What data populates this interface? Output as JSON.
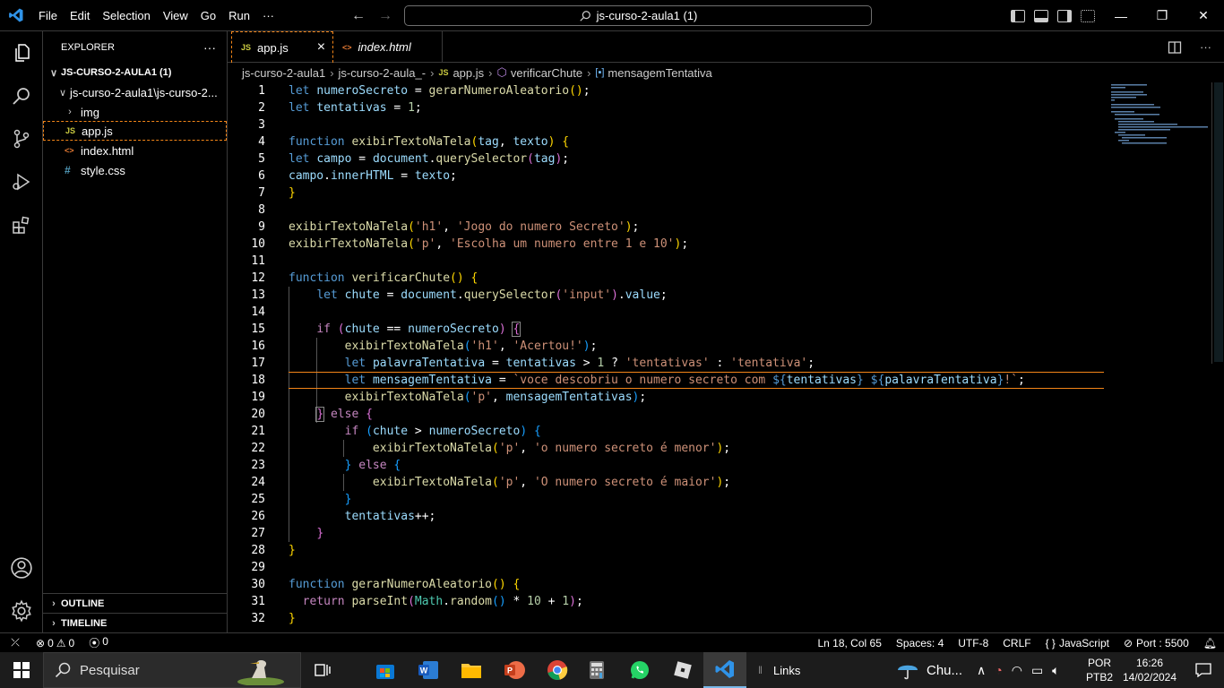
{
  "window": {
    "title": "js-curso-2-aula1 (1)",
    "menu": [
      "File",
      "Edit",
      "Selection",
      "View",
      "Go",
      "Run",
      "···"
    ]
  },
  "sidebar": {
    "header": "EXPLORER",
    "more": "···",
    "root": "JS-CURSO-2-AULA1 (1)",
    "folder": "js-curso-2-aula1\\js-curso-2...",
    "items": [
      {
        "label": "img",
        "icon": "folder-chevron"
      },
      {
        "label": "app.js",
        "icon": "JS"
      },
      {
        "label": "index.html",
        "icon": "<>"
      },
      {
        "label": "style.css",
        "icon": "#"
      }
    ],
    "outline": "OUTLINE",
    "timeline": "TIMELINE"
  },
  "tabs": [
    {
      "label": "app.js",
      "icon": "JS",
      "close": "×"
    },
    {
      "label": "index.html",
      "icon": "<>"
    }
  ],
  "breadcrumb": [
    "js-curso-2-aula1",
    "js-curso-2-aula_-",
    "app.js",
    "verificarChute",
    "mensagemTentativa"
  ],
  "statusbar": {
    "errors": "0",
    "warnings": "0",
    "ports": "0",
    "position": "Ln 18, Col 65",
    "spaces": "Spaces: 4",
    "encoding": "UTF-8",
    "eol": "CRLF",
    "language": "JavaScript",
    "port": "Port : 5500"
  },
  "taskbar": {
    "search_placeholder": "Pesquisar",
    "links": "Links",
    "weather": "Chu...",
    "lang1": "POR",
    "lang2": "PTB2",
    "time": "16:26",
    "date": "14/02/2024"
  },
  "colors": {
    "accent_orange": "#f38518",
    "keyword": "#569cd6",
    "string": "#ce9178",
    "function": "#dcdcaa",
    "variable": "#9cdcfe"
  }
}
